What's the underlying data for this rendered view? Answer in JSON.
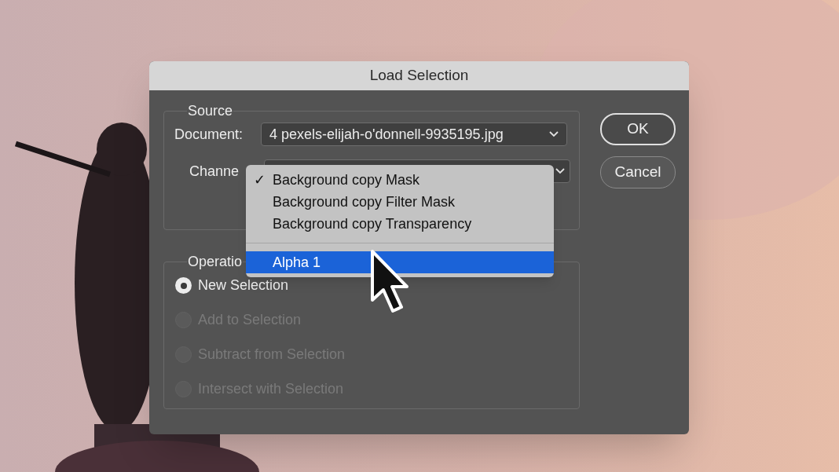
{
  "dialog": {
    "title": "Load Selection",
    "source": {
      "legend": "Source",
      "document": {
        "label": "Document:",
        "value": "4 pexels-elijah-o'donnell-9935195.jpg"
      },
      "channel": {
        "label": "Channe"
      }
    },
    "channel_menu": {
      "check_glyph": "✓",
      "groups": [
        {
          "items": [
            {
              "label": "Background copy Mask",
              "checked": true,
              "selected": false
            },
            {
              "label": "Background copy Filter Mask",
              "checked": false,
              "selected": false
            },
            {
              "label": "Background copy Transparency",
              "checked": false,
              "selected": false
            }
          ]
        },
        {
          "items": [
            {
              "label": "Alpha 1",
              "checked": false,
              "selected": true
            }
          ]
        }
      ]
    },
    "operation": {
      "legend": "Operatio",
      "options": [
        {
          "label": "New Selection",
          "selected": true,
          "disabled": false
        },
        {
          "label": "Add to Selection",
          "selected": false,
          "disabled": true
        },
        {
          "label": "Subtract from Selection",
          "selected": false,
          "disabled": true
        },
        {
          "label": "Intersect with Selection",
          "selected": false,
          "disabled": true
        }
      ]
    },
    "buttons": [
      "OK",
      "Cancel"
    ]
  }
}
